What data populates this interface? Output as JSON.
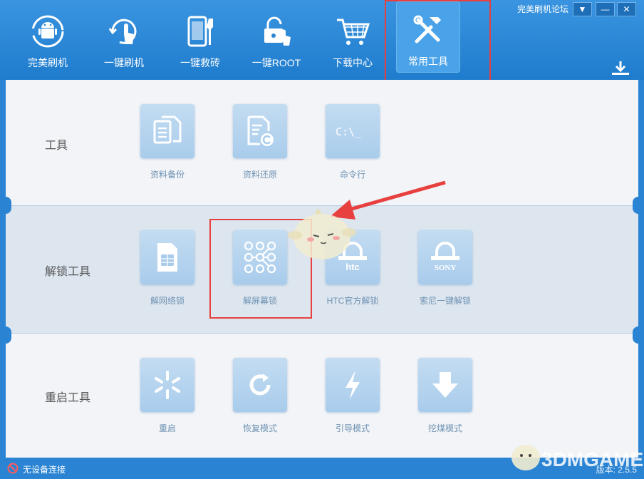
{
  "nav": {
    "items": [
      {
        "label": "完美刷机",
        "icon": "android-refresh-icon"
      },
      {
        "label": "一键刷机",
        "icon": "tap-refresh-icon"
      },
      {
        "label": "一键救砖",
        "icon": "phone-wrench-icon"
      },
      {
        "label": "一键ROOT",
        "icon": "unlock-tap-icon"
      },
      {
        "label": "下载中心",
        "icon": "shopping-cart-icon"
      },
      {
        "label": "常用工具",
        "icon": "tools-icon"
      }
    ],
    "active": "常用工具"
  },
  "titlebar": {
    "forum_link": "完美刷机论坛",
    "dropdown": "▼",
    "minimize": "—",
    "close": "✕"
  },
  "sections": [
    {
      "title": "工具",
      "tools": [
        {
          "label": "资料备份",
          "icon": "document-copy-icon"
        },
        {
          "label": "资料还原",
          "icon": "document-restore-icon"
        },
        {
          "label": "命令行",
          "icon": "command-line-icon"
        }
      ]
    },
    {
      "title": "解锁工具",
      "tools": [
        {
          "label": "解网络锁",
          "icon": "sim-card-icon"
        },
        {
          "label": "解屏幕锁",
          "icon": "pattern-lock-icon"
        },
        {
          "label": "HTC官方解锁",
          "icon": "htc-lock-icon"
        },
        {
          "label": "索尼一键解锁",
          "icon": "sony-lock-icon"
        }
      ]
    },
    {
      "title": "重启工具",
      "tools": [
        {
          "label": "重启",
          "icon": "spark-icon"
        },
        {
          "label": "恢复模式",
          "icon": "refresh-icon"
        },
        {
          "label": "引导模式",
          "icon": "lightning-icon"
        },
        {
          "label": "挖煤模式",
          "icon": "download-arrow-icon"
        }
      ]
    }
  ],
  "status": {
    "text": "无设备连接",
    "version": "版本: 2.5.5"
  },
  "watermark": "3DMGAME",
  "colors": {
    "primary": "#2a84d3",
    "highlight": "#e8403f",
    "tile": "#b3d3ee"
  }
}
